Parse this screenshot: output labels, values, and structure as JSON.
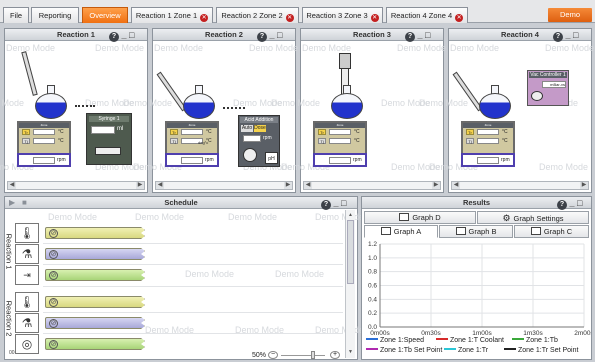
{
  "tabs": [
    {
      "label": "File",
      "closable": false,
      "active": false
    },
    {
      "label": "Reporting",
      "closable": false,
      "active": false
    },
    {
      "label": "Overview",
      "closable": false,
      "active": true
    },
    {
      "label": "Reaction 1 Zone 1",
      "closable": true,
      "active": false
    },
    {
      "label": "Reaction 2 Zone 2",
      "closable": true,
      "active": false
    },
    {
      "label": "Reaction 3 Zone 3",
      "closable": true,
      "active": false
    },
    {
      "label": "Reaction 4 Zone 4",
      "closable": true,
      "active": false
    }
  ],
  "demo_button": "Demo",
  "close_glyph": "✕",
  "watermark": "Demo Mode",
  "help_glyph": "?",
  "minimize_glyph": "_",
  "maximize_glyph": "□",
  "reactions": [
    {
      "title": "Reaction 1",
      "device": {
        "title": "Syringe 1",
        "unit": "ml"
      }
    },
    {
      "title": "Reaction 2",
      "device": {
        "title": "Acid Addition",
        "tab_a": "Auto",
        "tab_b": "Dose",
        "unit": "rpm",
        "unit2": "pH"
      }
    },
    {
      "title": "Reaction 3"
    },
    {
      "title": "Reaction 4",
      "device": {
        "title": "Vac Controller 1",
        "unit": "mBar-vs"
      }
    }
  ],
  "controller": {
    "head": "Zone",
    "row1_badge": "Tr",
    "row2_badge": "Tj",
    "temp_unit": "°C",
    "rpm_unit": "rpm",
    "r2_setpoint": "deg°c"
  },
  "schedule": {
    "title": "Schedule",
    "play_glyph": "▶",
    "stop_glyph": "■",
    "rows": [
      {
        "label": "Reaction 1",
        "icons": [
          "thermometer-icon",
          "stirrer-icon",
          "syringe-icon"
        ]
      },
      {
        "label": "Reaction 2",
        "icons": [
          "thermometer-icon",
          "stirrer-icon",
          "ph-probe-icon"
        ]
      }
    ],
    "zoom": "50%",
    "zoom_minus": "−",
    "zoom_plus": "+",
    "ruler_start": "00"
  },
  "results": {
    "title": "Results",
    "buttons": {
      "graph_d": "Graph D",
      "graph_settings": "Graph Settings"
    },
    "graph_tabs": [
      "Graph A",
      "Graph B",
      "Graph C"
    ],
    "legend": [
      {
        "name": "Zone 1:Speed",
        "color": "#2b6fd6"
      },
      {
        "name": "Zone 1:T Coolant",
        "color": "#d62b2b"
      },
      {
        "name": "Zone 1:Tb",
        "color": "#3aa83a"
      },
      {
        "name": "Zone 1:Tb Set Point",
        "color": "#b02ab0"
      },
      {
        "name": "Zone 1:Tr",
        "color": "#2bc6d6"
      },
      {
        "name": "Zone 1:Tr Set Point",
        "color": "#222222"
      }
    ]
  },
  "chart_data": {
    "type": "line",
    "x_ticks": [
      "0m00s",
      "0m30s",
      "1m00s",
      "1m30s",
      "2m00s"
    ],
    "y_ticks": [
      "0.0",
      "0.2",
      "0.4",
      "0.6",
      "0.8",
      "1.0",
      "1.2"
    ],
    "ylim": [
      0,
      1.2
    ],
    "grid": true,
    "legend_placement": "bottom",
    "series": []
  },
  "colors": {
    "accent": "#f07012",
    "flask_liquid": "#2233cc",
    "rpm_border": "#4f3fae",
    "device_header": "#5a5f66"
  }
}
